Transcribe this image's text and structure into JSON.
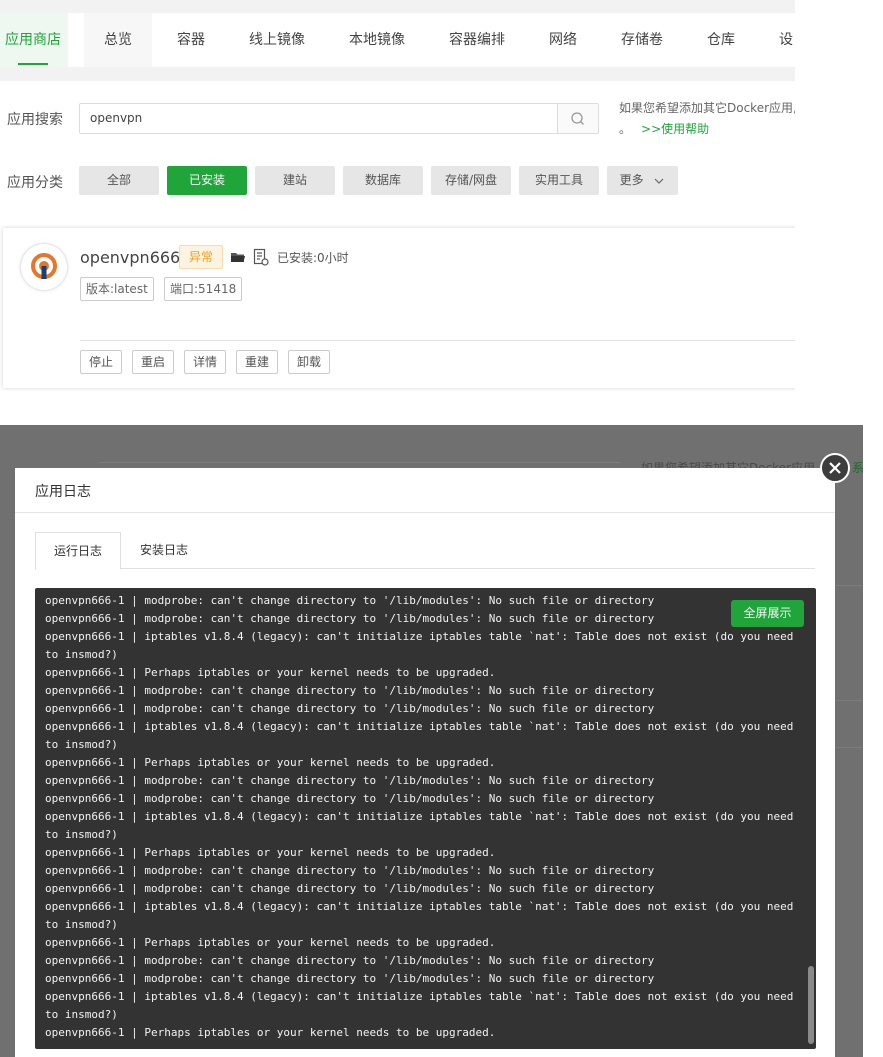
{
  "nav": {
    "tabs": [
      {
        "label": "应用商店",
        "active": true
      },
      {
        "label": "总览"
      },
      {
        "label": "容器"
      },
      {
        "label": "线上镜像"
      },
      {
        "label": "本地镜像"
      },
      {
        "label": "容器编排"
      },
      {
        "label": "网络"
      },
      {
        "label": "存储卷"
      },
      {
        "label": "仓库"
      },
      {
        "label": "设"
      }
    ]
  },
  "search": {
    "label": "应用搜索",
    "value": "openvpn",
    "hint_line1": "如果您希望添加其它Docker应用,",
    "hint_line2_prefix": "。",
    "help_link": ">>使用帮助"
  },
  "categories": {
    "label": "应用分类",
    "items": [
      "全部",
      "已安装",
      "建站",
      "数据库",
      "存储/网盘",
      "实用工具"
    ],
    "active": "已安装",
    "more": "更多"
  },
  "app": {
    "name": "openvpn666",
    "status": "异常",
    "installed": "已安装:0小时",
    "version": "版本:latest",
    "port": "端口:51418",
    "actions": [
      "停止",
      "重启",
      "详情",
      "重建",
      "卸载"
    ]
  },
  "background_ghost": {
    "hint": "如果您希望添加其它Docker应用",
    "link_fragment": "系"
  },
  "modal": {
    "title": "应用日志",
    "tabs": [
      "运行日志",
      "安装日志"
    ],
    "active_tab": "运行日志",
    "fullscreen_label": "全屏展示",
    "log_lines": [
      "openvpn666-1 | modprobe: can't change directory to '/lib/modules': No such file or directory",
      "openvpn666-1 | modprobe: can't change directory to '/lib/modules': No such file or directory",
      "openvpn666-1 | iptables v1.8.4 (legacy): can't initialize iptables table `nat': Table does not exist (do you need to insmod?)",
      "openvpn666-1 | Perhaps iptables or your kernel needs to be upgraded.",
      "openvpn666-1 | modprobe: can't change directory to '/lib/modules': No such file or directory",
      "openvpn666-1 | modprobe: can't change directory to '/lib/modules': No such file or directory",
      "openvpn666-1 | iptables v1.8.4 (legacy): can't initialize iptables table `nat': Table does not exist (do you need to insmod?)",
      "openvpn666-1 | Perhaps iptables or your kernel needs to be upgraded.",
      "openvpn666-1 | modprobe: can't change directory to '/lib/modules': No such file or directory",
      "openvpn666-1 | modprobe: can't change directory to '/lib/modules': No such file or directory",
      "openvpn666-1 | iptables v1.8.4 (legacy): can't initialize iptables table `nat': Table does not exist (do you need to insmod?)",
      "openvpn666-1 | Perhaps iptables or your kernel needs to be upgraded.",
      "openvpn666-1 | modprobe: can't change directory to '/lib/modules': No such file or directory",
      "openvpn666-1 | modprobe: can't change directory to '/lib/modules': No such file or directory",
      "openvpn666-1 | iptables v1.8.4 (legacy): can't initialize iptables table `nat': Table does not exist (do you need to insmod?)",
      "openvpn666-1 | Perhaps iptables or your kernel needs to be upgraded.",
      "openvpn666-1 | modprobe: can't change directory to '/lib/modules': No such file or directory",
      "openvpn666-1 | modprobe: can't change directory to '/lib/modules': No such file or directory",
      "openvpn666-1 | iptables v1.8.4 (legacy): can't initialize iptables table `nat': Table does not exist (do you need to insmod?)",
      "openvpn666-1 | Perhaps iptables or your kernel needs to be upgraded."
    ]
  },
  "colors": {
    "accent": "#20a53a",
    "warning": "#f0a020",
    "console_bg": "#333333",
    "overlay": "#707070"
  },
  "icons": [
    "search-icon",
    "chevron-down-icon",
    "folder-icon",
    "log-file-icon",
    "openvpn-logo",
    "close-icon"
  ]
}
